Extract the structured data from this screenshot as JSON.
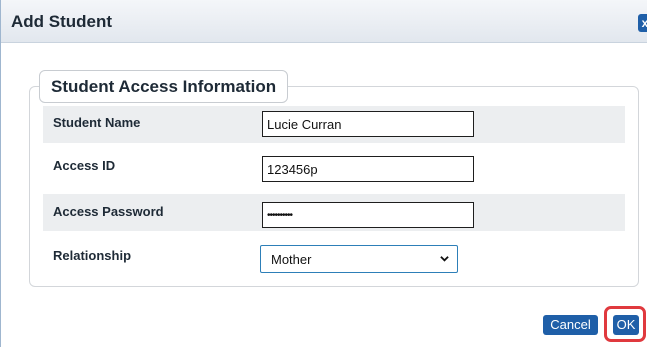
{
  "dialog": {
    "title": "Add Student",
    "close_icon": "close-icon",
    "close_label": "x"
  },
  "section": {
    "legend": "Student Access Information"
  },
  "fields": {
    "student_name": {
      "label": "Student Name",
      "value": "Lucie Curran"
    },
    "access_id": {
      "label": "Access ID",
      "value": "123456p"
    },
    "access_password": {
      "label": "Access Password",
      "value": "••••••••••"
    },
    "relationship": {
      "label": "Relationship",
      "value": "Mother"
    }
  },
  "buttons": {
    "cancel": "Cancel",
    "ok": "OK"
  },
  "colors": {
    "accent": "#1f5fa8",
    "highlight": "#e0393e",
    "row_shade": "#eceef0"
  }
}
